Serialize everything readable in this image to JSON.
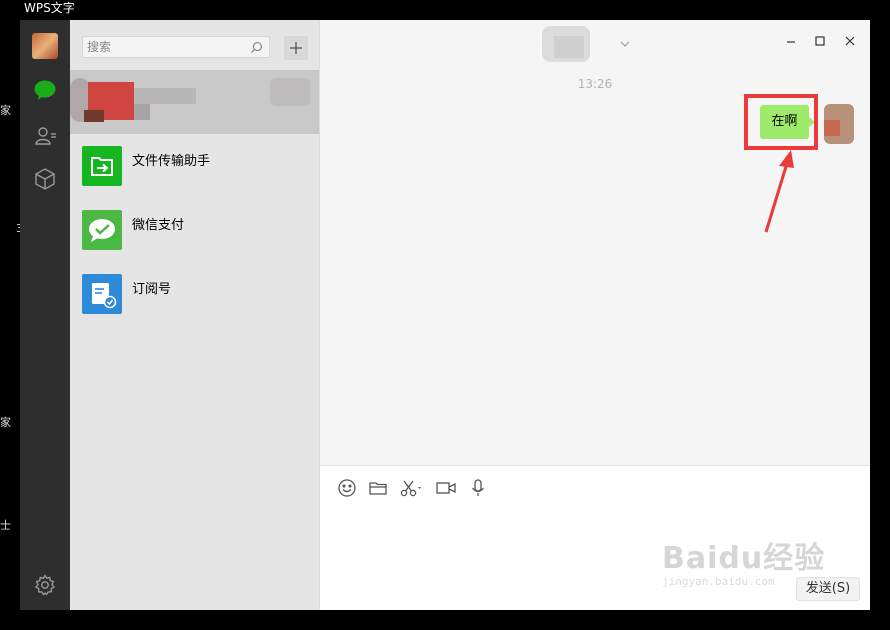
{
  "desktop": {
    "app_title": "WPS文字",
    "edge_fragments": [
      "家",
      "3",
      "家",
      "士"
    ]
  },
  "search": {
    "placeholder": "搜索"
  },
  "conversations": [
    {
      "name": "",
      "icon": "blurred-avatar",
      "selected": true
    },
    {
      "name": "文件传输助手",
      "icon": "file-transfer-icon",
      "color": "#15b61f"
    },
    {
      "name": "微信支付",
      "icon": "wechat-pay-icon",
      "color": "#4ab843"
    },
    {
      "name": "订阅号",
      "icon": "subscription-icon",
      "color": "#2f8ad8"
    }
  ],
  "chat": {
    "timestamp": "13:26",
    "message": "在啊",
    "send_label": "发送(S)",
    "tools": [
      "emoji-icon",
      "folder-icon",
      "scissors-icon",
      "video-call-icon",
      "microphone-icon"
    ]
  },
  "watermark": {
    "line1": "Baidu经验",
    "line2": "jingyan.baidu.com"
  },
  "colors": {
    "bubble": "#9eea6a",
    "highlight": "#ea3a3a",
    "nav": "#2e2e2e",
    "accent": "#1aad19"
  }
}
